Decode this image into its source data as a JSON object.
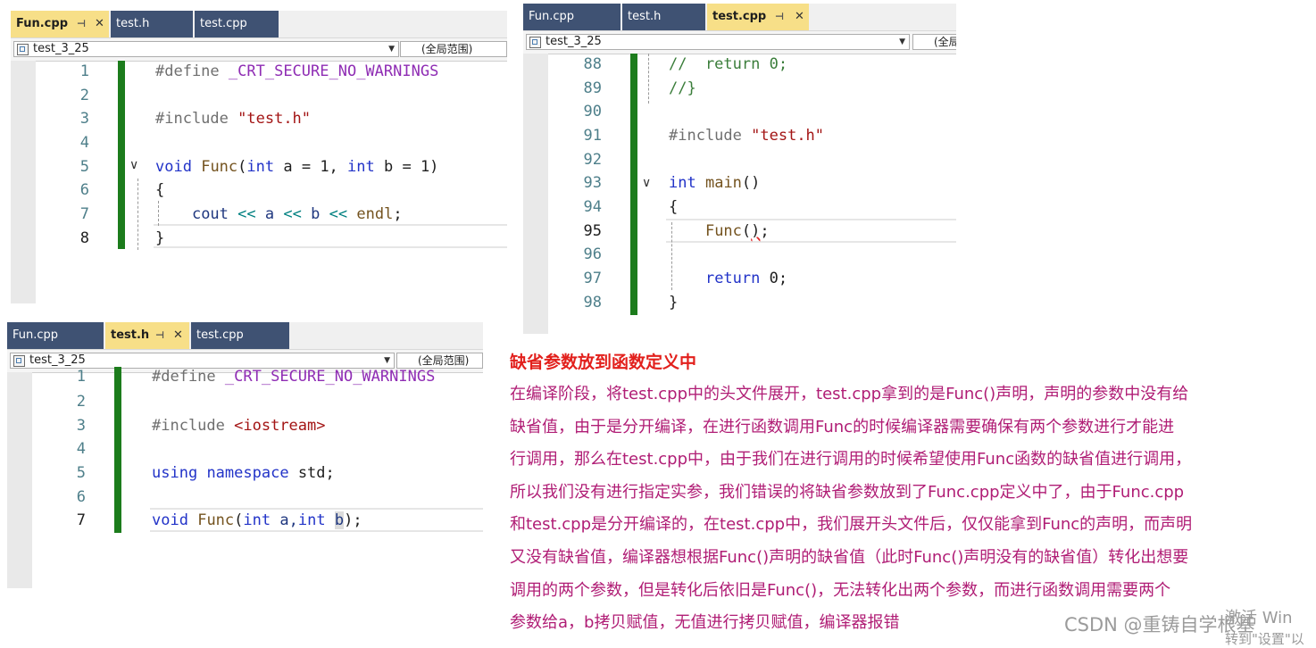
{
  "editors": {
    "fun_cpp": {
      "tabs": [
        {
          "label": "Fun.cpp",
          "active": true
        },
        {
          "label": "test.h",
          "active": false
        },
        {
          "label": "test.cpp",
          "active": false
        }
      ],
      "scope": "test_3_25",
      "range": "(全局范围)",
      "line_numbers": [
        "1",
        "2",
        "3",
        "4",
        "5",
        "6",
        "7",
        "8"
      ],
      "line1": [
        "#define",
        "_CRT_SECURE_NO_WARNINGS"
      ],
      "line3": [
        "#include",
        "\"test.h\""
      ],
      "line5": [
        "void",
        "Func",
        "(",
        "int",
        "a = 1, ",
        "int",
        "b = 1)"
      ],
      "line6": [
        "{"
      ],
      "line7": [
        "cout",
        "<<",
        "a",
        "<<",
        "b",
        "<<",
        "endl",
        ";"
      ],
      "line8": [
        "}"
      ]
    },
    "test_cpp": {
      "tabs": [
        {
          "label": "Fun.cpp",
          "active": false
        },
        {
          "label": "test.h",
          "active": false
        },
        {
          "label": "test.cpp",
          "active": true
        }
      ],
      "scope": "test_3_25",
      "range": "(全局范围)",
      "line_numbers": [
        "88",
        "89",
        "90",
        "91",
        "92",
        "93",
        "94",
        "95",
        "96",
        "97",
        "98"
      ],
      "line88": [
        "//  return 0;"
      ],
      "line89": [
        "//}"
      ],
      "line91": [
        "#include",
        "\"test.h\""
      ],
      "line93": [
        "int",
        "main",
        "()"
      ],
      "line94": [
        "{"
      ],
      "line95": [
        "Func",
        "(",
        ")",
        ";"
      ],
      "line97": [
        "return",
        "0;"
      ],
      "line98": [
        "}"
      ]
    },
    "test_h": {
      "tabs": [
        {
          "label": "Fun.cpp",
          "active": false
        },
        {
          "label": "test.h",
          "active": true
        },
        {
          "label": "test.cpp",
          "active": false
        }
      ],
      "scope": "test_3_25",
      "range": "(全局范围)",
      "line_numbers": [
        "1",
        "2",
        "3",
        "4",
        "5",
        "6",
        "7"
      ],
      "line1": [
        "#define",
        "_CRT_SECURE_NO_WARNINGS"
      ],
      "line3": [
        "#include",
        "<iostream>"
      ],
      "line5": [
        "using",
        "namespace",
        "std;"
      ],
      "line7": [
        "void",
        "Func",
        "(",
        "int",
        "a,",
        "int",
        "b",
        ")",
        ";"
      ]
    }
  },
  "explanation": {
    "title": "缺省参数放到函数定义中",
    "lines": [
      "在编译阶段，将test.cpp中的头文件展开，test.cpp拿到的是Func()声明，声明的参数中没有给",
      "缺省值，由于是分开编译，在进行函数调用Func的时候编译器需要确保有两个参数进行才能进",
      "行调用，那么在test.cpp中，由于我们在进行调用的时候希望使用Func函数的缺省值进行调用，",
      "所以我们没有进行指定实参，我们错误的将缺省参数放到了Func.cpp定义中了，由于Func.cpp",
      "和test.cpp是分开编译的，在test.cpp中，我们展开头文件后，仅仅能拿到Func的声明，而声明",
      "又没有缺省值，编译器想根据Func()声明的缺省值（此时Func()声明没有的缺省值）转化出想要",
      "调用的两个参数，但是转化后依旧是Func()，无法转化出两个参数，而进行函数调用需要两个",
      "参数给a，b拷贝赋值，无值进行拷贝赋值，编译器报错"
    ]
  },
  "watermark": "CSDN @重铸自学根基",
  "activation": {
    "line1": "激活 Win",
    "line2": "转到\"设置\"以"
  }
}
